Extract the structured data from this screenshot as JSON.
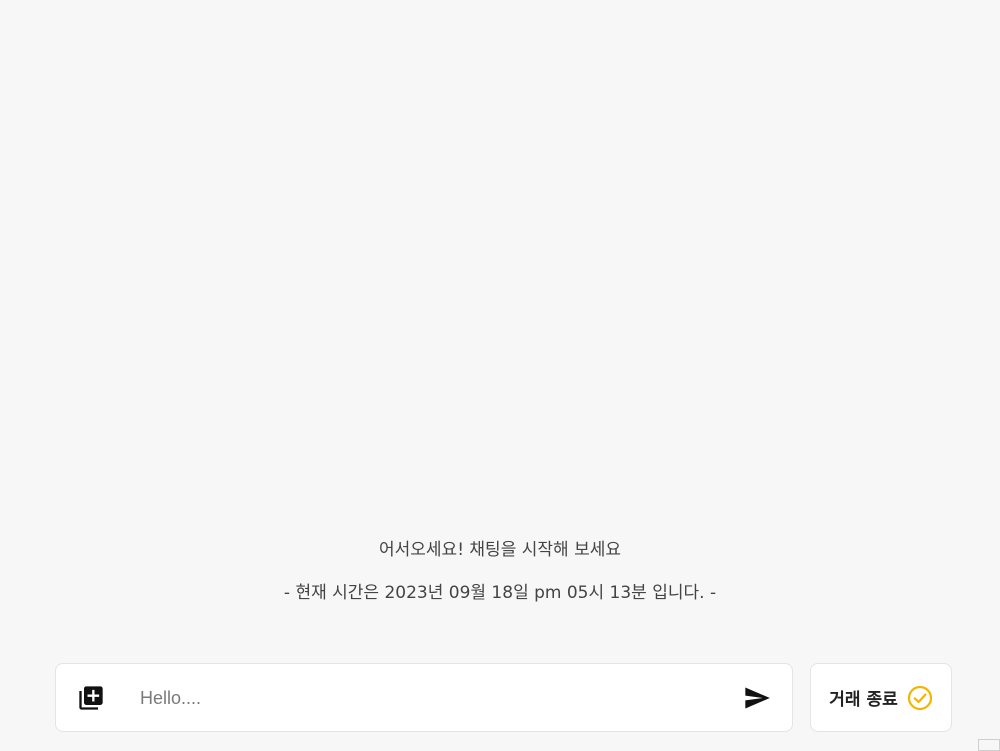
{
  "chat": {
    "welcome_message": "어서오세요! 채팅을 시작해 보세요",
    "current_time_message": "- 현재 시간은 2023년 09월 18일 pm 05시 13분 입니다. -"
  },
  "composer": {
    "placeholder": "Hello....",
    "attach_icon": "add-to-library-icon",
    "send_icon": "send-icon"
  },
  "end_deal": {
    "label": "거래 종료",
    "icon": "check-circle-icon",
    "icon_color": "#f4b400"
  },
  "colors": {
    "background": "#f7f7f7",
    "panel": "#ffffff",
    "border": "#e4e4e4",
    "accent": "#f4b400"
  }
}
